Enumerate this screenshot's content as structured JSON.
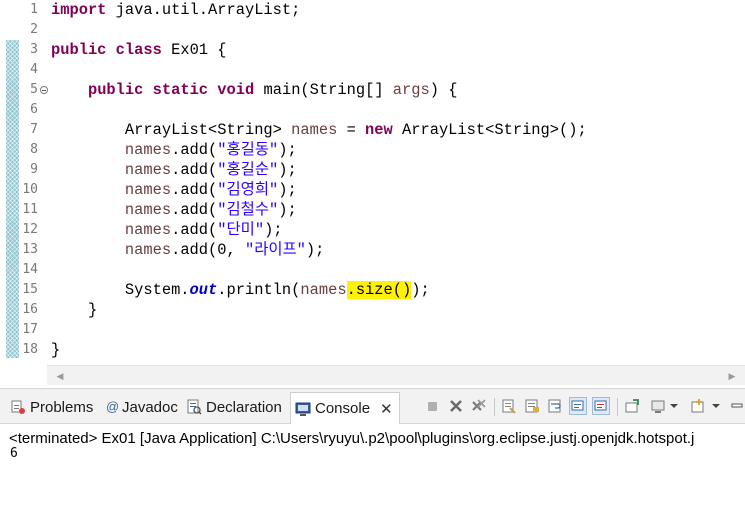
{
  "editor": {
    "line_numbers": [
      "1",
      "2",
      "3",
      "4",
      "5",
      "6",
      "7",
      "8",
      "9",
      "10",
      "11",
      "12",
      "13",
      "14",
      "15",
      "16",
      "17",
      "18"
    ],
    "lines": [
      [
        {
          "t": "import",
          "k": "kw"
        },
        {
          "t": " java.util.ArrayList;",
          "k": ""
        }
      ],
      [],
      [
        {
          "t": "public",
          "k": "kw"
        },
        {
          "t": " ",
          "k": ""
        },
        {
          "t": "class",
          "k": "kw"
        },
        {
          "t": " Ex01 {",
          "k": ""
        }
      ],
      [],
      [
        {
          "t": "    ",
          "k": ""
        },
        {
          "t": "public",
          "k": "kw"
        },
        {
          "t": " ",
          "k": ""
        },
        {
          "t": "static",
          "k": "kw"
        },
        {
          "t": " ",
          "k": ""
        },
        {
          "t": "void",
          "k": "kw"
        },
        {
          "t": " main(String[] ",
          "k": ""
        },
        {
          "t": "args",
          "k": "var"
        },
        {
          "t": ") {",
          "k": ""
        }
      ],
      [],
      [
        {
          "t": "        ArrayList<String> ",
          "k": ""
        },
        {
          "t": "names",
          "k": "var"
        },
        {
          "t": " = ",
          "k": ""
        },
        {
          "t": "new",
          "k": "kw"
        },
        {
          "t": " ArrayList<String>();",
          "k": ""
        }
      ],
      [
        {
          "t": "        ",
          "k": ""
        },
        {
          "t": "names",
          "k": "var"
        },
        {
          "t": ".add(",
          "k": ""
        },
        {
          "t": "\"홍길동\"",
          "k": "str"
        },
        {
          "t": ");",
          "k": ""
        }
      ],
      [
        {
          "t": "        ",
          "k": ""
        },
        {
          "t": "names",
          "k": "var"
        },
        {
          "t": ".add(",
          "k": ""
        },
        {
          "t": "\"홍길순\"",
          "k": "str"
        },
        {
          "t": ");",
          "k": ""
        }
      ],
      [
        {
          "t": "        ",
          "k": ""
        },
        {
          "t": "names",
          "k": "var"
        },
        {
          "t": ".add(",
          "k": ""
        },
        {
          "t": "\"김영희\"",
          "k": "str"
        },
        {
          "t": ");",
          "k": ""
        }
      ],
      [
        {
          "t": "        ",
          "k": ""
        },
        {
          "t": "names",
          "k": "var"
        },
        {
          "t": ".add(",
          "k": ""
        },
        {
          "t": "\"김철수\"",
          "k": "str"
        },
        {
          "t": ");",
          "k": ""
        }
      ],
      [
        {
          "t": "        ",
          "k": ""
        },
        {
          "t": "names",
          "k": "var"
        },
        {
          "t": ".add(",
          "k": ""
        },
        {
          "t": "\"단미\"",
          "k": "str"
        },
        {
          "t": ");",
          "k": ""
        }
      ],
      [
        {
          "t": "        ",
          "k": ""
        },
        {
          "t": "names",
          "k": "var"
        },
        {
          "t": ".add(0, ",
          "k": ""
        },
        {
          "t": "\"라이프\"",
          "k": "str"
        },
        {
          "t": ");",
          "k": ""
        }
      ],
      [],
      [
        {
          "t": "        System.",
          "k": ""
        },
        {
          "t": "out",
          "k": "fld-it"
        },
        {
          "t": ".println(",
          "k": ""
        },
        {
          "t": "names",
          "k": "var"
        },
        {
          "t": ".size()",
          "k": "hl"
        },
        {
          "t": ");",
          "k": ""
        }
      ],
      [
        {
          "t": "    }",
          "k": ""
        }
      ],
      [],
      [
        {
          "t": "}",
          "k": ""
        }
      ]
    ],
    "fold_marker_line": 5
  },
  "bottom_panel": {
    "tabs": [
      {
        "label": "Problems",
        "icon": "problems-icon",
        "active": false
      },
      {
        "label": "Javadoc",
        "icon": "javadoc-icon",
        "active": false
      },
      {
        "label": "Declaration",
        "icon": "declaration-icon",
        "active": false
      },
      {
        "label": "Console",
        "icon": "console-icon",
        "active": true
      }
    ],
    "close_symbol": "✕",
    "console_header": "<terminated> Ex01 [Java Application] C:\\Users\\ryuyu\\.p2\\pool\\plugins\\org.eclipse.justj.openjdk.hotspot.j",
    "console_output": "6"
  },
  "colors": {
    "keyword": "#7f0055",
    "string": "#2a00ff",
    "variable": "#6a3e3e",
    "highlight": "#fff200"
  }
}
